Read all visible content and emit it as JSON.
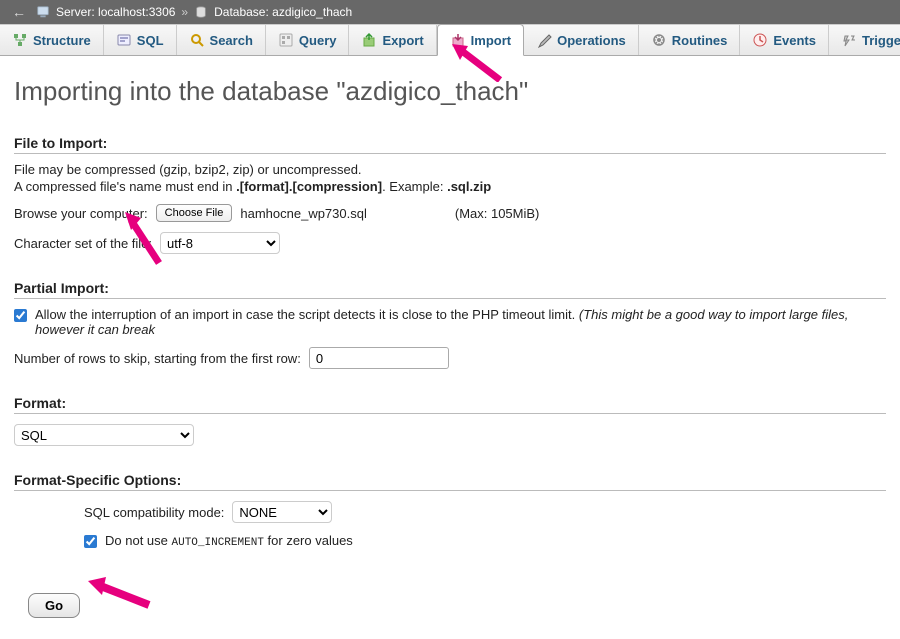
{
  "topbar": {
    "server_label": "Server:",
    "server_value": "localhost:3306",
    "sep": "»",
    "db_label": "Database:",
    "db_value": "azdigico_thach"
  },
  "tabs": [
    {
      "label": "Structure",
      "icon": "structure"
    },
    {
      "label": "SQL",
      "icon": "sql"
    },
    {
      "label": "Search",
      "icon": "search"
    },
    {
      "label": "Query",
      "icon": "query"
    },
    {
      "label": "Export",
      "icon": "export"
    },
    {
      "label": "Import",
      "icon": "import",
      "active": true
    },
    {
      "label": "Operations",
      "icon": "operations"
    },
    {
      "label": "Routines",
      "icon": "routines"
    },
    {
      "label": "Events",
      "icon": "events"
    },
    {
      "label": "Triggers",
      "icon": "triggers"
    }
  ],
  "heading": "Importing into the database \"azdigico_thach\"",
  "file_to_import": {
    "title": "File to Import:",
    "hint1": "File may be compressed (gzip, bzip2, zip) or uncompressed.",
    "hint2_prefix": "A compressed file's name must end in ",
    "hint2_bold1": ".[format].[compression]",
    "hint2_mid": ". Example: ",
    "hint2_bold2": ".sql.zip",
    "browse_label": "Browse your computer:",
    "choose_file": "Choose File",
    "filename": "hamhocne_wp730.sql",
    "max": "(Max: 105MiB)",
    "charset_label": "Character set of the file:",
    "charset_value": "utf-8"
  },
  "partial_import": {
    "title": "Partial Import:",
    "interrupt_label": "Allow the interruption of an import in case the script detects it is close to the PHP timeout limit.",
    "interrupt_note": "(This might be a good way to import large files, however it can break",
    "skip_label": "Number of rows to skip, starting from the first row:",
    "skip_value": "0"
  },
  "format": {
    "title": "Format:",
    "value": "SQL"
  },
  "format_options": {
    "title": "Format-Specific Options:",
    "compat_label": "SQL compatibility mode:",
    "compat_value": "NONE",
    "noauto_prefix": "Do not use ",
    "noauto_mono": "auto_increment",
    "noauto_suffix": " for zero values"
  },
  "go_label": "Go"
}
